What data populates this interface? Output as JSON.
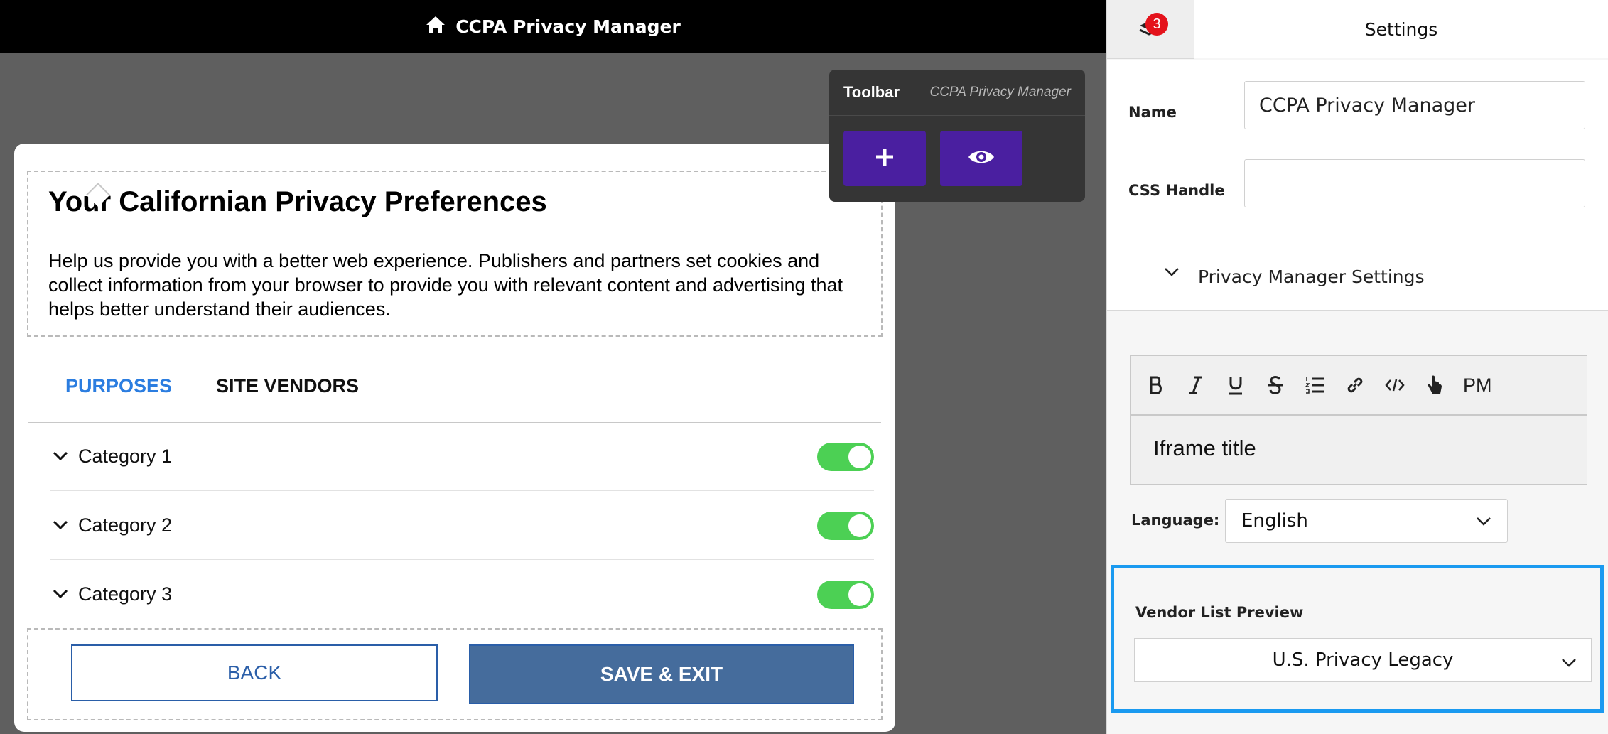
{
  "topbar": {
    "title": "CCPA Privacy Manager",
    "icon": "home-icon"
  },
  "toolbar": {
    "title": "Toolbar",
    "subtitle": "CCPA Privacy Manager",
    "buttons": [
      {
        "icon": "plus-icon"
      },
      {
        "icon": "eye-icon"
      }
    ],
    "accent_color": "#4a1fa0"
  },
  "modal": {
    "title": "Your Californian Privacy Preferences",
    "description": "Help us provide you with a better web experience. Publishers and partners set cookies and collect information from your browser to provide you with relevant content and advertising that helps better understand their audiences.",
    "tabs": [
      {
        "label": "PURPOSES",
        "active": true
      },
      {
        "label": "SITE VENDORS",
        "active": false
      }
    ],
    "categories": [
      {
        "label": "Category 1",
        "enabled": true
      },
      {
        "label": "Category 2",
        "enabled": true
      },
      {
        "label": "Category 3",
        "enabled": true
      }
    ],
    "back_label": "BACK",
    "save_label": "SAVE & EXIT",
    "toggle_color": "#4cd054"
  },
  "panel": {
    "notification_count": "3",
    "settings_tab": "Settings",
    "name_label": "Name",
    "name_value": "CCPA Privacy Manager",
    "css_handle_label": "CSS Handle",
    "css_handle_value": "",
    "section_title": "Privacy Manager Settings",
    "editor": {
      "tools": [
        "bold-icon",
        "italic-icon",
        "underline-icon",
        "strikethrough-icon",
        "ordered-list-icon",
        "link-icon",
        "code-icon",
        "pointer-icon"
      ],
      "pm_label": "PM",
      "content": "Iframe title"
    },
    "language_label": "Language:",
    "language_value": "English",
    "vendor_list_label": "Vendor List Preview",
    "vendor_list_value": "U.S. Privacy Legacy",
    "highlight_color": "#1a9af0"
  }
}
